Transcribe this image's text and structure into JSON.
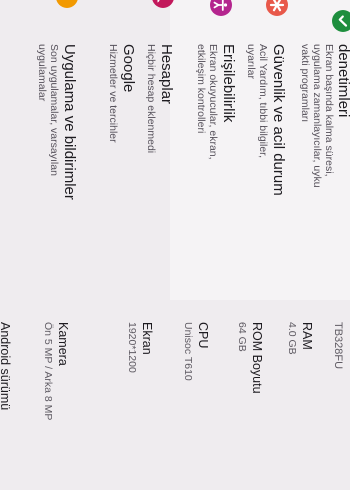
{
  "settings_list": {
    "items": [
      {
        "title": "denetimleri",
        "subtitle_lines": [
          "Ekran başında kalma süresi,",
          "uygulama zamanlayıcılar, uyku",
          "vakti programları"
        ],
        "icon": "check-shield-icon",
        "color": "#1e8e3e"
      },
      {
        "title": "Güvenlik ve acil durum",
        "subtitle_lines": [
          "Acil Yardım, tıbbi bilgiler,",
          "uyarılar"
        ],
        "icon": "medical-asterisk-icon",
        "color": "#e8584a"
      },
      {
        "title": "Erişilebilirlik",
        "subtitle_lines": [
          "Ekran okuyucular, ekran,",
          "etkileşim kontrolleri"
        ],
        "icon": "accessibility-icon",
        "color": "#b4248e"
      },
      {
        "title": "Hesaplar",
        "subtitle_lines": [
          "Hiçbir hesap eklenmedi"
        ],
        "icon": "account-icon",
        "color": "#c2185b"
      },
      {
        "title": "Google",
        "subtitle_lines": [
          "Hizmetler ve tercihler"
        ],
        "icon": "google-icon",
        "color": "#3b7de9"
      },
      {
        "title": "Uygulama ve bildirimler",
        "subtitle_lines": [
          "Son uygulamalar, varsayılan",
          "uygulamalar"
        ],
        "icon": "apps-icon",
        "color": "#f29900"
      }
    ]
  },
  "device_info": {
    "model": "TB328FU",
    "specs": [
      {
        "label": "RAM",
        "value": "4.0 GB"
      },
      {
        "label": "ROM Boyutu",
        "value": "64 GB"
      },
      {
        "label": "CPU",
        "value": "Unisoc T610"
      },
      {
        "label": "Ekran",
        "value": "1920*1200"
      },
      {
        "label": "Kamera",
        "value": "Ön 5 MP / Arka 8 MP"
      }
    ],
    "cut_off_text": "Android sürümü"
  }
}
